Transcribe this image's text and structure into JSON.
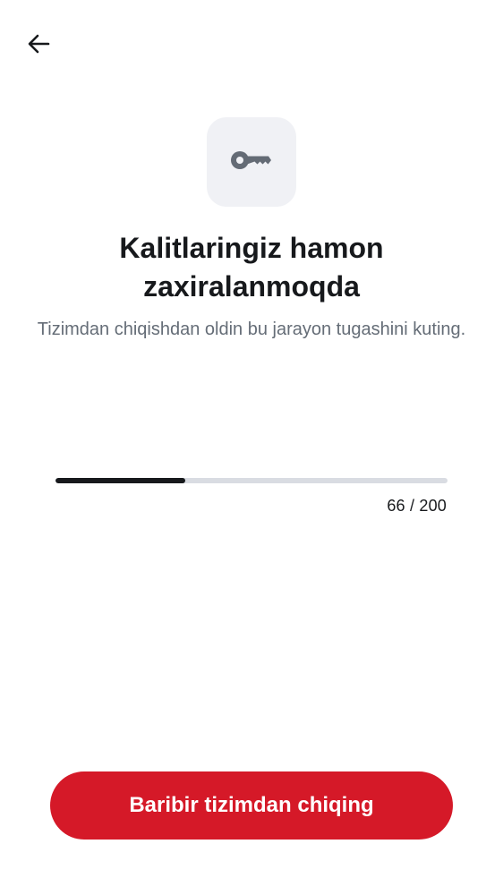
{
  "icons": {
    "back": "arrow-left-icon",
    "hero": "key-icon"
  },
  "title": "Kalitlaringiz hamon zaxiralanmoqda",
  "subtitle": "Tizimdan chiqishdan oldin bu jarayon tugashini kuting.",
  "progress": {
    "current": 66,
    "total": 200,
    "label": "66 / 200"
  },
  "actions": {
    "logout_label": "Baribir tizimdan chiqing"
  },
  "colors": {
    "primary_button": "#d51928",
    "progress_fill": "#17191c",
    "progress_track": "#d9dce2",
    "icon_tile": "#f0f1f5",
    "subtitle_text": "#656d77"
  }
}
